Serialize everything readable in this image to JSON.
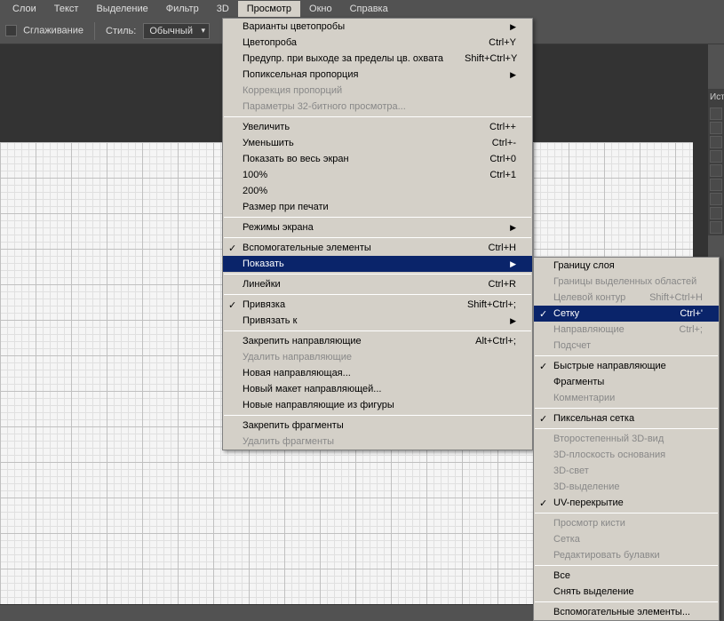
{
  "menubar": [
    "Слои",
    "Текст",
    "Выделение",
    "Фильтр",
    "3D",
    "Просмотр",
    "Окно",
    "Справка"
  ],
  "menubar_active": "Просмотр",
  "toolbar": {
    "smoothing": "Сглаживание",
    "style_label": "Стиль:",
    "style_value": "Обычный"
  },
  "sidepanel": {
    "tab": "Ист"
  },
  "menu1": [
    {
      "t": "item",
      "label": "Варианты цветопробы",
      "sub": true
    },
    {
      "t": "item",
      "label": "Цветопроба",
      "sc": "Ctrl+Y"
    },
    {
      "t": "item",
      "label": "Предупр. при выходе за пределы цв. охвата",
      "sc": "Shift+Ctrl+Y"
    },
    {
      "t": "item",
      "label": "Попиксельная пропорция",
      "sub": true
    },
    {
      "t": "item",
      "label": "Коррекция пропорций",
      "disabled": true
    },
    {
      "t": "item",
      "label": "Параметры 32-битного просмотра...",
      "disabled": true
    },
    {
      "t": "sep"
    },
    {
      "t": "item",
      "label": "Увеличить",
      "sc": "Ctrl++"
    },
    {
      "t": "item",
      "label": "Уменьшить",
      "sc": "Ctrl+-"
    },
    {
      "t": "item",
      "label": "Показать во весь экран",
      "sc": "Ctrl+0"
    },
    {
      "t": "item",
      "label": "100%",
      "sc": "Ctrl+1"
    },
    {
      "t": "item",
      "label": "200%"
    },
    {
      "t": "item",
      "label": "Размер при печати"
    },
    {
      "t": "sep"
    },
    {
      "t": "item",
      "label": "Режимы экрана",
      "sub": true
    },
    {
      "t": "sep"
    },
    {
      "t": "item",
      "label": "Вспомогательные элементы",
      "sc": "Ctrl+H",
      "check": true
    },
    {
      "t": "item",
      "label": "Показать",
      "sub": true,
      "hl": true
    },
    {
      "t": "sep"
    },
    {
      "t": "item",
      "label": "Линейки",
      "sc": "Ctrl+R"
    },
    {
      "t": "sep"
    },
    {
      "t": "item",
      "label": "Привязка",
      "sc": "Shift+Ctrl+;",
      "check": true
    },
    {
      "t": "item",
      "label": "Привязать к",
      "sub": true
    },
    {
      "t": "sep"
    },
    {
      "t": "item",
      "label": "Закрепить направляющие",
      "sc": "Alt+Ctrl+;"
    },
    {
      "t": "item",
      "label": "Удалить направляющие",
      "disabled": true
    },
    {
      "t": "item",
      "label": "Новая направляющая..."
    },
    {
      "t": "item",
      "label": "Новый макет направляющей..."
    },
    {
      "t": "item",
      "label": "Новые направляющие из фигуры"
    },
    {
      "t": "sep"
    },
    {
      "t": "item",
      "label": "Закрепить фрагменты"
    },
    {
      "t": "item",
      "label": "Удалить фрагменты",
      "disabled": true
    }
  ],
  "menu2": [
    {
      "t": "item",
      "label": "Границу слоя"
    },
    {
      "t": "item",
      "label": "Границы выделенных областей",
      "disabled": true
    },
    {
      "t": "item",
      "label": "Целевой контур",
      "sc": "Shift+Ctrl+H",
      "disabled": true
    },
    {
      "t": "item",
      "label": "Сетку",
      "sc": "Ctrl+'",
      "check": true,
      "hl": true
    },
    {
      "t": "item",
      "label": "Направляющие",
      "sc": "Ctrl+;",
      "disabled": true
    },
    {
      "t": "item",
      "label": "Подсчет",
      "disabled": true
    },
    {
      "t": "sep"
    },
    {
      "t": "item",
      "label": "Быстрые направляющие",
      "check": true
    },
    {
      "t": "item",
      "label": "Фрагменты"
    },
    {
      "t": "item",
      "label": "Комментарии",
      "disabled": true
    },
    {
      "t": "sep"
    },
    {
      "t": "item",
      "label": "Пиксельная сетка",
      "check": true
    },
    {
      "t": "sep"
    },
    {
      "t": "item",
      "label": "Второстепенный 3D-вид",
      "disabled": true
    },
    {
      "t": "item",
      "label": "3D-плоскость основания",
      "disabled": true
    },
    {
      "t": "item",
      "label": "3D-свет",
      "disabled": true
    },
    {
      "t": "item",
      "label": "3D-выделение",
      "disabled": true
    },
    {
      "t": "item",
      "label": "UV-перекрытие",
      "check": true
    },
    {
      "t": "sep"
    },
    {
      "t": "item",
      "label": "Просмотр кисти",
      "disabled": true
    },
    {
      "t": "item",
      "label": "Сетка",
      "disabled": true
    },
    {
      "t": "item",
      "label": "Редактировать булавки",
      "disabled": true
    },
    {
      "t": "sep"
    },
    {
      "t": "item",
      "label": "Все"
    },
    {
      "t": "item",
      "label": "Снять выделение"
    },
    {
      "t": "sep"
    },
    {
      "t": "item",
      "label": "Вспомогательные элементы..."
    }
  ]
}
